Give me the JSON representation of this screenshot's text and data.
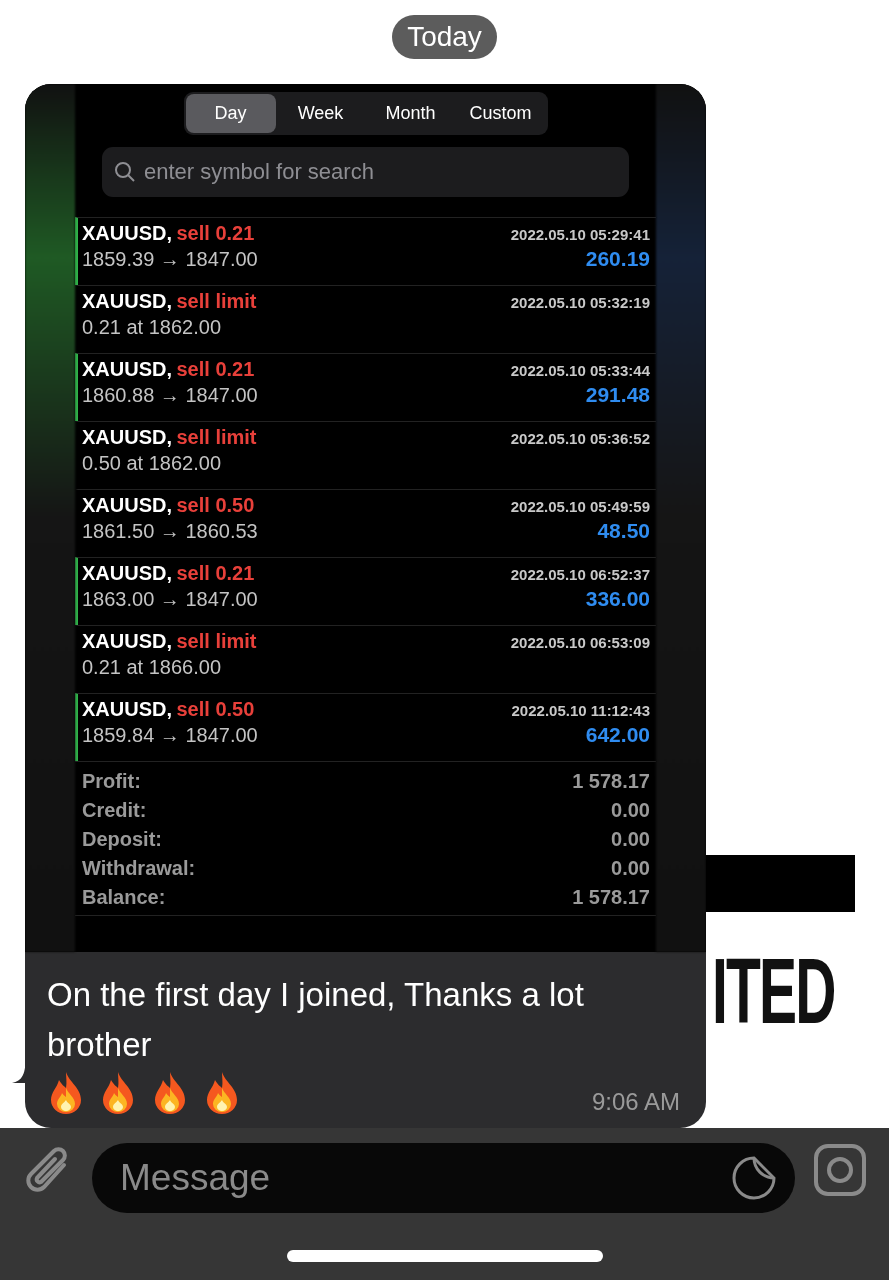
{
  "date_pill": "Today",
  "wallpaper": {
    "text": "ITED"
  },
  "screenshot": {
    "tabs": [
      {
        "label": "Day",
        "selected": true
      },
      {
        "label": "Week",
        "selected": false
      },
      {
        "label": "Month",
        "selected": false
      },
      {
        "label": "Custom",
        "selected": false
      }
    ],
    "search": {
      "placeholder": "enter symbol for search"
    },
    "rows": [
      {
        "kind": "deal",
        "symbol": "XAUUSD,",
        "action": "sell 0.21",
        "detail": "1859.39 → 1847.00",
        "time": "2022.05.10 05:29:41",
        "profit": "260.19"
      },
      {
        "kind": "order",
        "symbol": "XAUUSD,",
        "action": "sell limit",
        "detail": "0.21 at 1862.00",
        "time": "2022.05.10 05:32:19"
      },
      {
        "kind": "deal",
        "symbol": "XAUUSD,",
        "action": "sell 0.21",
        "detail": "1860.88 → 1847.00",
        "time": "2022.05.10 05:33:44",
        "profit": "291.48"
      },
      {
        "kind": "order",
        "symbol": "XAUUSD,",
        "action": "sell limit",
        "detail": "0.50 at 1862.00",
        "time": "2022.05.10 05:36:52"
      },
      {
        "kind": "order",
        "symbol": "XAUUSD,",
        "action": "sell 0.50",
        "detail": "1861.50 → 1860.53",
        "time": "2022.05.10 05:49:59",
        "profit": "48.50"
      },
      {
        "kind": "deal",
        "symbol": "XAUUSD,",
        "action": "sell 0.21",
        "detail": "1863.00 → 1847.00",
        "time": "2022.05.10 06:52:37",
        "profit": "336.00"
      },
      {
        "kind": "order",
        "symbol": "XAUUSD,",
        "action": "sell limit",
        "detail": "0.21 at 1866.00",
        "time": "2022.05.10 06:53:09"
      },
      {
        "kind": "deal",
        "symbol": "XAUUSD,",
        "action": "sell 0.50",
        "detail": "1859.84 → 1847.00",
        "time": "2022.05.10 11:12:43",
        "profit": "642.00"
      }
    ],
    "summary": [
      {
        "label": "Profit:",
        "value": "1 578.17"
      },
      {
        "label": "Credit:",
        "value": "0.00"
      },
      {
        "label": "Deposit:",
        "value": "0.00"
      },
      {
        "label": "Withdrawal:",
        "value": "0.00"
      },
      {
        "label": "Balance:",
        "value": "1 578.17"
      }
    ]
  },
  "message": {
    "text": "On the first day I joined, Thanks a lot brother",
    "emoji": [
      {
        "kind": "fire"
      },
      {
        "kind": "fire"
      },
      {
        "kind": "fire"
      },
      {
        "kind": "fire"
      }
    ],
    "time": "9:06 AM"
  },
  "composer": {
    "placeholder": "Message"
  }
}
